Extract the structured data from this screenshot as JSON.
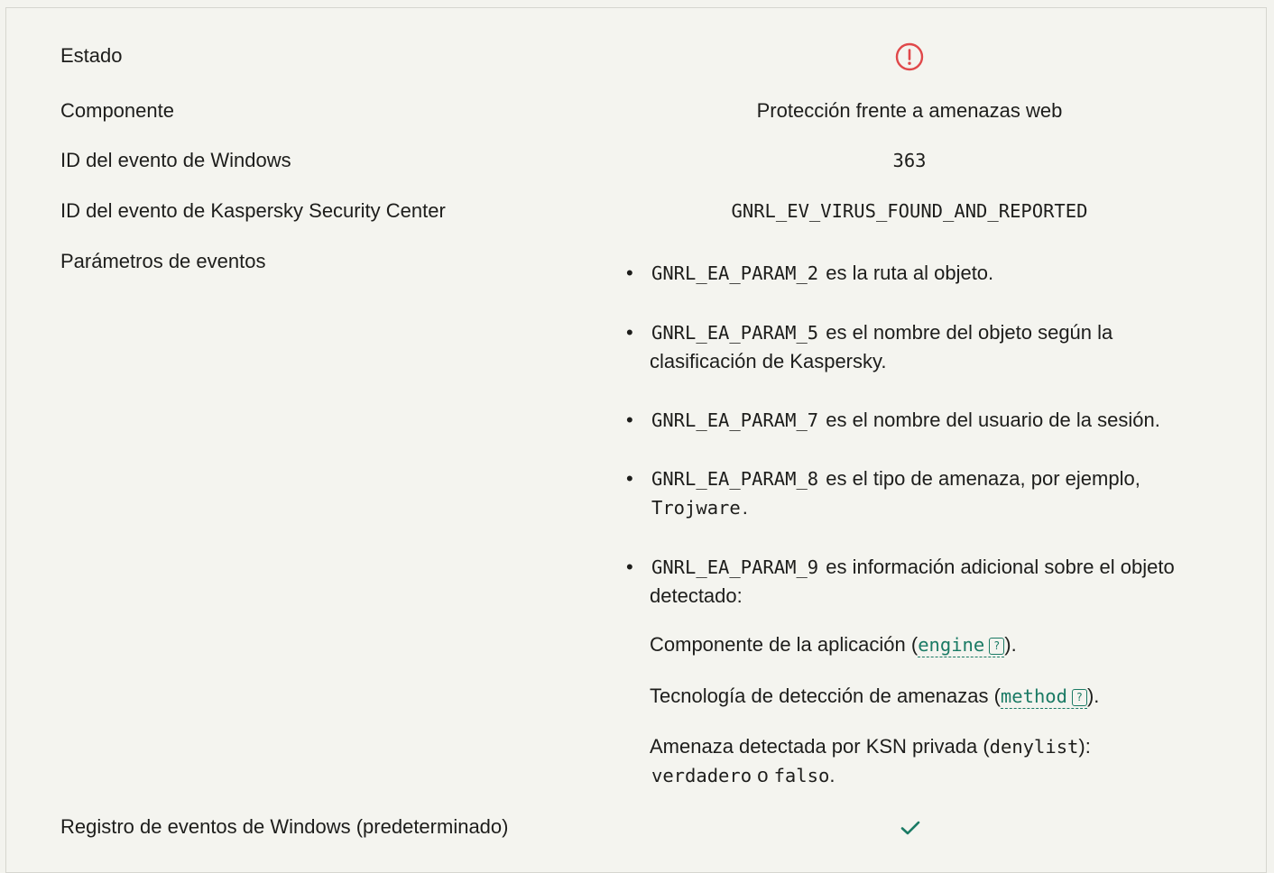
{
  "rows": {
    "estado": {
      "label": "Estado",
      "icon": "error-circle-icon",
      "icon_color": "#e0484a"
    },
    "componente": {
      "label": "Componente",
      "value": "Protección frente a amenazas web"
    },
    "windows_id": {
      "label": "ID del evento de Windows",
      "value": "363"
    },
    "ksc_id": {
      "label": "ID del evento de Kaspersky Security Center",
      "value": "GNRL_EV_VIRUS_FOUND_AND_REPORTED"
    },
    "params": {
      "label": "Parámetros de eventos"
    },
    "registro": {
      "label": "Registro de eventos de Windows (predeterminado)",
      "icon": "checkmark-icon",
      "icon_color": "#1a7a64"
    }
  },
  "params": [
    {
      "code": "GNRL_EA_PARAM_2",
      "text": "es la ruta al objeto."
    },
    {
      "code": "GNRL_EA_PARAM_5",
      "text": "es el nombre del objeto según la clasificación de Kaspersky."
    },
    {
      "code": "GNRL_EA_PARAM_7",
      "text": "es el nombre del usuario de la sesión."
    },
    {
      "code": "GNRL_EA_PARAM_8",
      "text": "es el tipo de amenaza, por ejemplo,",
      "example": "Trojware",
      "end": "."
    },
    {
      "code": "GNRL_EA_PARAM_9",
      "text": "es información adicional sobre el objeto detectado:"
    }
  ],
  "details": {
    "engine": {
      "before": "Componente de la aplicación (",
      "link": "engine",
      "help": "?",
      "after": ")."
    },
    "method": {
      "before": "Tecnología de detección de amenazas (",
      "link": "method",
      "help": "?",
      "after": ")."
    },
    "denylist": {
      "before": "Amenaza detectada por KSN privada (",
      "code": "denylist",
      "after": "):",
      "val_true": "verdadero",
      "or": "o",
      "val_false": "falso",
      "end": "."
    }
  },
  "colors": {
    "accent": "#1a7a64",
    "error": "#e0484a",
    "background": "#f4f4ef"
  }
}
